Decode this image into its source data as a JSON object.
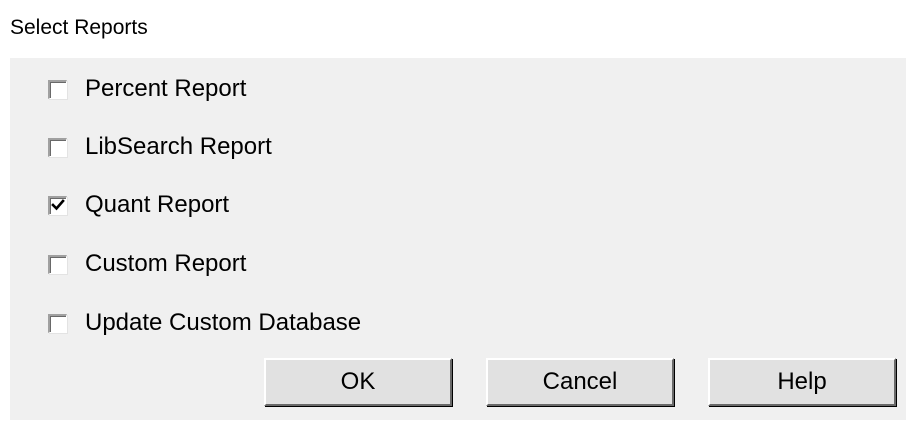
{
  "window": {
    "title": "Select Reports"
  },
  "options": [
    {
      "label": "Percent Report",
      "checked": false
    },
    {
      "label": "LibSearch Report",
      "checked": false
    },
    {
      "label": "Quant Report",
      "checked": true
    },
    {
      "label": "Custom Report",
      "checked": false
    },
    {
      "label": "Update Custom Database",
      "checked": false
    }
  ],
  "buttons": {
    "ok_label": "OK",
    "cancel_label": "Cancel",
    "help_label": "Help"
  },
  "icons": {
    "check": "checkmark-icon"
  },
  "colors": {
    "dialog_background": "#f0f0f0",
    "button_face": "#e1e1e1",
    "title_background": "#ffffff"
  }
}
